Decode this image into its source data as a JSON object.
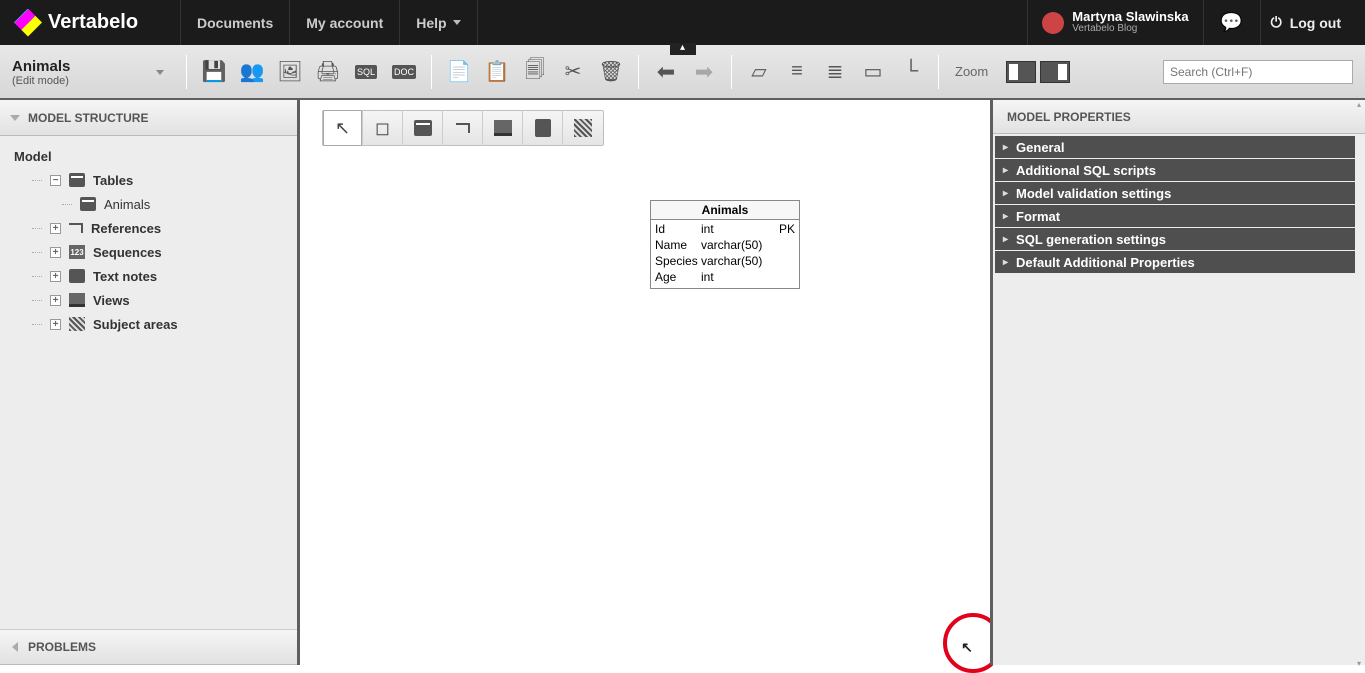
{
  "header": {
    "brand": "Vertabelo",
    "nav": [
      "Documents",
      "My account",
      "Help"
    ],
    "user_name": "Martyna Slawinska",
    "user_sub": "Vertabelo Blog",
    "logout": "Log out"
  },
  "document": {
    "title": "Animals",
    "mode": "(Edit mode)"
  },
  "toolbar": {
    "zoom_label": "Zoom",
    "search_placeholder": "Search (Ctrl+F)"
  },
  "left_panel": {
    "structure_title": "MODEL STRUCTURE",
    "problems_title": "PROBLEMS",
    "root": "Model",
    "nodes": {
      "tables": "Tables",
      "animals": "Animals",
      "references": "References",
      "sequences": "Sequences",
      "text_notes": "Text notes",
      "views": "Views",
      "subject_areas": "Subject areas"
    }
  },
  "erd_table": {
    "name": "Animals",
    "columns": [
      {
        "name": "Id",
        "type": "int",
        "key": "PK"
      },
      {
        "name": "Name",
        "type": "varchar(50)",
        "key": ""
      },
      {
        "name": "Species",
        "type": "varchar(50)",
        "key": ""
      },
      {
        "name": "Age",
        "type": "int",
        "key": ""
      }
    ]
  },
  "right_panel": {
    "title": "MODEL PROPERTIES",
    "sections": [
      "General",
      "Additional SQL scripts",
      "Model validation settings",
      "Format",
      "SQL generation settings",
      "Default Additional Properties"
    ]
  }
}
